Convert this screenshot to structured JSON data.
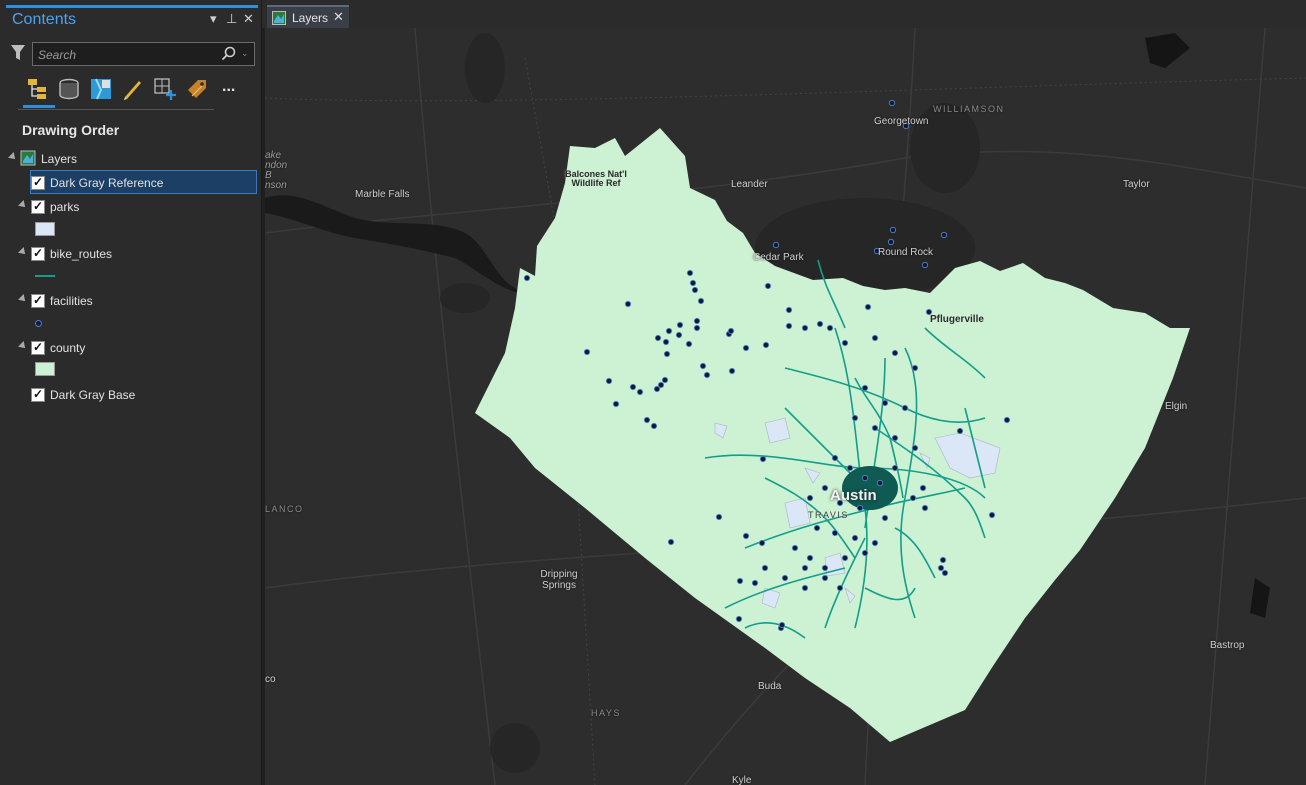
{
  "contents_pane": {
    "title": "Contents",
    "search_placeholder": "Search",
    "section_title": "Drawing Order",
    "more_label": "..."
  },
  "layers": {
    "root": "Layers",
    "items": [
      {
        "label": "Dark Gray Reference",
        "checked": true,
        "selected": true
      },
      {
        "label": "parks",
        "checked": true
      },
      {
        "label": "bike_routes",
        "checked": true
      },
      {
        "label": "facilities",
        "checked": true
      },
      {
        "label": "county",
        "checked": true
      },
      {
        "label": "Dark Gray Base",
        "checked": true
      }
    ]
  },
  "tabs": [
    {
      "label": "Layers"
    }
  ],
  "map_labels": {
    "williamson": "WILLIAMSON",
    "georgetown": "Georgetown",
    "leander": "Leander",
    "taylor": "Taylor",
    "marble_falls": "Marble Falls",
    "cedar_park": "Cedar Park",
    "round_rock": "Round Rock",
    "pflugerville": "Pflugerville",
    "elgin": "Elgin",
    "austin": "Austin",
    "travis": "TRAVIS",
    "blanco": "LANCO",
    "dripping_springs": "Dripping Springs",
    "bastrop": "Bastrop",
    "buda": "Buda",
    "hays": "HAYS",
    "kyle": "Kyle",
    "falls": "co",
    "balcones": "Balcones Nat'l Wildlife Ref",
    "lake_partial": "ake ndon B nson"
  },
  "colors": {
    "accent": "#2e8fdd",
    "county_fill": "#cdf2d3",
    "bike_routes": "#129e8a",
    "facilities": "#0b1a3d",
    "parks": "#dbe7f7"
  }
}
